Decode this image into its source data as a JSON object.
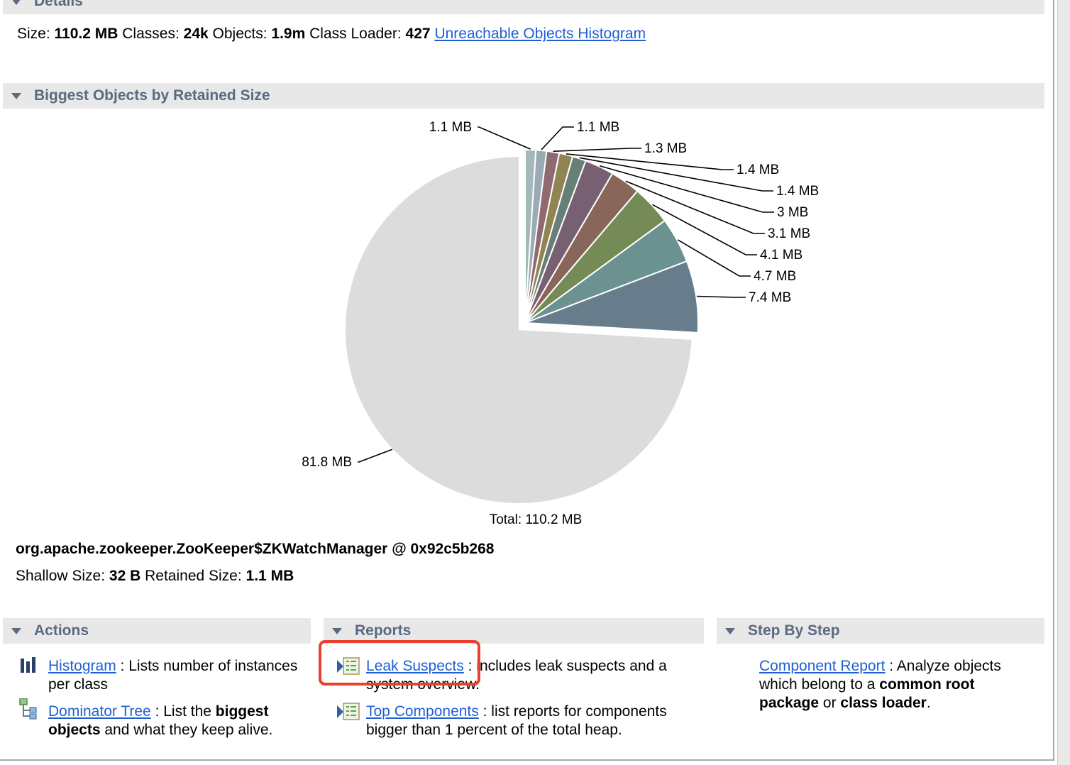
{
  "details": {
    "header": "Details",
    "size_label": "Size:",
    "size_value": "110.2 MB",
    "classes_label": "Classes:",
    "classes_value": "24k",
    "objects_label": "Objects:",
    "objects_value": "1.9m",
    "classloader_label": "Class Loader:",
    "classloader_value": "427",
    "unreachable_link": "Unreachable Objects Histogram"
  },
  "biggest": {
    "header": "Biggest Objects by Retained Size"
  },
  "chart_data": {
    "type": "pie",
    "title": "Biggest Objects by Retained Size",
    "unit": "MB",
    "total_label": "Total: 110.2 MB",
    "start": "top",
    "direction": "clockwise",
    "slices": [
      {
        "label": "1.1 MB",
        "value": 1.1,
        "color": "#a3b8b9",
        "exploded": true
      },
      {
        "label": "1.1 MB",
        "value": 1.1,
        "color": "#9aabb5",
        "exploded": true
      },
      {
        "label": "1.3 MB",
        "value": 1.3,
        "color": "#8f6a70",
        "exploded": true
      },
      {
        "label": "1.4 MB",
        "value": 1.4,
        "color": "#8f8452",
        "exploded": true
      },
      {
        "label": "1.4 MB",
        "value": 1.4,
        "color": "#687f78",
        "exploded": true
      },
      {
        "label": "3 MB",
        "value": 3.0,
        "color": "#786073",
        "exploded": true
      },
      {
        "label": "3.1 MB",
        "value": 3.1,
        "color": "#886659",
        "exploded": true
      },
      {
        "label": "4.1 MB",
        "value": 4.1,
        "color": "#748b56",
        "exploded": true
      },
      {
        "label": "4.7 MB",
        "value": 4.7,
        "color": "#6b9191",
        "exploded": true
      },
      {
        "label": "7.4 MB",
        "value": 7.4,
        "color": "#677d8c",
        "exploded": true
      },
      {
        "label": "81.8 MB",
        "value": 81.8,
        "color": "#dcdcdc",
        "exploded": false
      }
    ]
  },
  "selected_object": {
    "title": "org.apache.zookeeper.ZooKeeper$ZKWatchManager @ 0x92c5b268",
    "shallow_label": "Shallow Size:",
    "shallow_value": "32 B",
    "retained_label": "Retained Size:",
    "retained_value": "1.1 MB"
  },
  "actions": {
    "header": "Actions",
    "items": [
      {
        "link": "Histogram",
        "sep": " : ",
        "text": "Lists number of instances per class",
        "icon": "histogram-icon"
      },
      {
        "link": "Dominator Tree",
        "sep": " : ",
        "text_before": "List the ",
        "bold": "biggest objects",
        "text_after": " and what they keep alive.",
        "icon": "dominator-tree-icon"
      }
    ]
  },
  "reports": {
    "header": "Reports",
    "items": [
      {
        "link": "Leak Suspects",
        "sep": " : ",
        "text": "includes leak suspects and a system overview.",
        "icon": "report-icon"
      },
      {
        "link": "Top Components",
        "sep": " : ",
        "text": "list reports for components bigger than 1 percent of the total heap.",
        "icon": "report-icon"
      }
    ]
  },
  "step_by_step": {
    "header": "Step By Step",
    "items": [
      {
        "link": "Component Report",
        "sep": " : ",
        "text_before": "Analyze objects which belong to a ",
        "bold1": "common root package",
        "mid": " or ",
        "bold2": "class loader",
        "text_after": "."
      }
    ]
  },
  "highlight_color": "#e8412c",
  "link_color": "#1f5fd4"
}
